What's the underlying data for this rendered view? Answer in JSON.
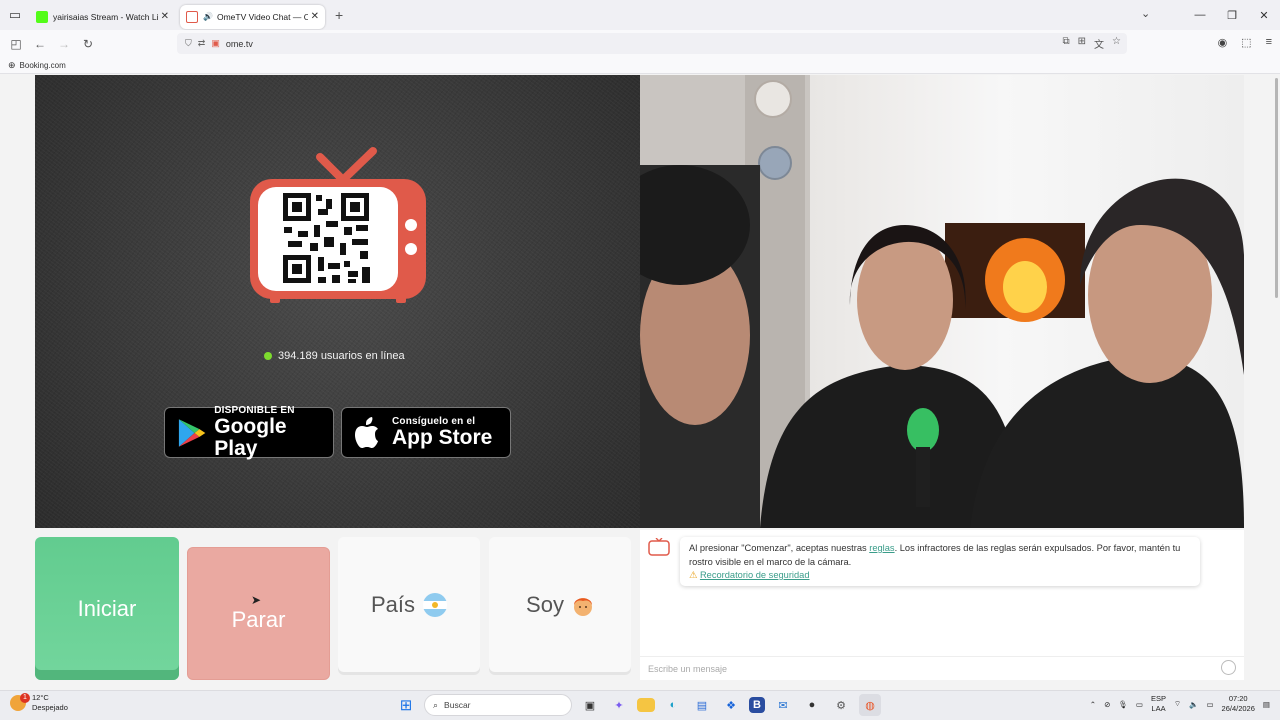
{
  "browser": {
    "tabs": [
      {
        "title": "yairisaias Stream - Watch Live o",
        "favicon_color": "#53fc18",
        "active": false
      },
      {
        "title": "OmeTV Video Chat — Ome",
        "favicon_color": "#e05a4a",
        "active": true
      }
    ],
    "url": "ome.tv",
    "bookmark": "Booking.com"
  },
  "left": {
    "online_text": "394.189 usuarios en línea",
    "google_play_small": "DISPONIBLE EN",
    "google_play_big": "Google Play",
    "app_store_small": "Consíguelo en el",
    "app_store_big": "App Store"
  },
  "buttons": {
    "start": "Iniciar",
    "stop": "Parar",
    "country": "País",
    "gender": "Soy"
  },
  "chat": {
    "notice_prefix": "Al presionar \"Comenzar\", aceptas nuestras ",
    "notice_link": "reglas",
    "notice_suffix": ". Los infractores de las reglas serán expulsados. Por favor, mantén tu rostro visible en el marco de la cámara.",
    "safety_link": "Recordatorio de seguridad",
    "input_placeholder": "Escribe un mensaje"
  },
  "taskbar": {
    "temperature": "12°C",
    "weather": "Despejado",
    "weather_badge": "1",
    "search_placeholder": "Buscar",
    "lang_top": "ESP",
    "lang_bottom": "LAA",
    "time": "07:20",
    "date": "26/4/2026"
  },
  "colors": {
    "start": "#62cc8f",
    "stop": "#eaa9a1",
    "accent_link": "#3a9d8a",
    "online_dot": "#7ddb2e"
  }
}
